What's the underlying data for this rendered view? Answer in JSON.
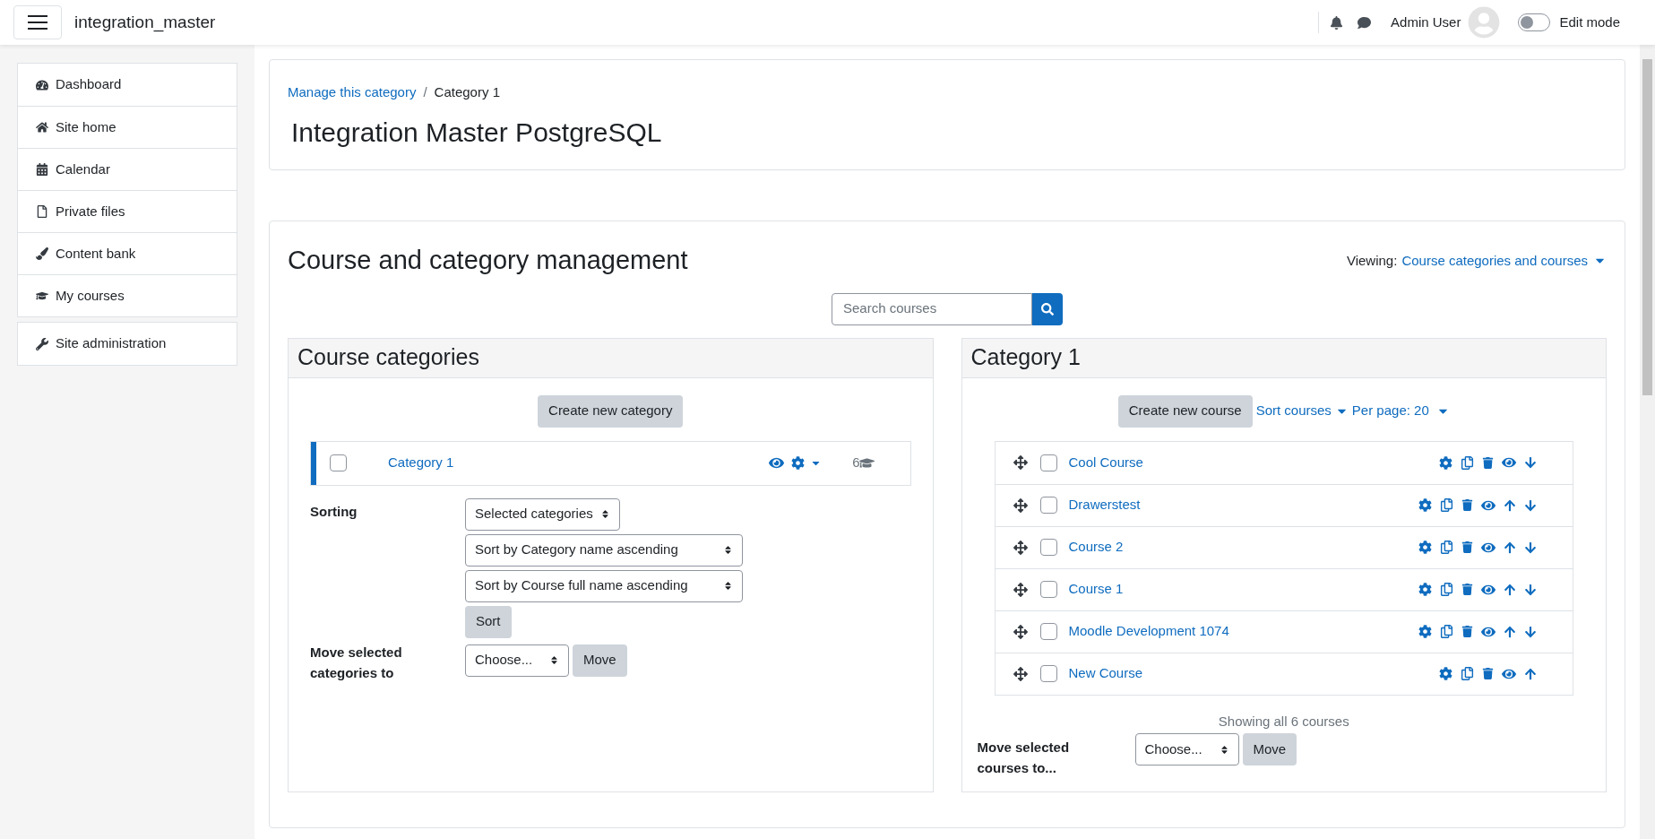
{
  "header": {
    "site_name": "integration_master",
    "user_name": "Admin User",
    "edit_mode": {
      "label": "Edit mode",
      "on": false
    }
  },
  "sidebar": {
    "groups": [
      [
        {
          "kind": "dashboard",
          "label": "Dashboard"
        },
        {
          "kind": "home",
          "label": "Site home"
        },
        {
          "kind": "calendar",
          "label": "Calendar"
        },
        {
          "kind": "file",
          "label": "Private files"
        },
        {
          "kind": "brush",
          "label": "Content bank"
        },
        {
          "kind": "courses",
          "label": "My courses"
        }
      ],
      [
        {
          "kind": "wrench",
          "label": "Site administration"
        }
      ]
    ]
  },
  "page_header": {
    "separator": "/",
    "breadcrumb": [
      {
        "label": "Manage this category",
        "link": true
      },
      {
        "label": "Category 1",
        "link": false
      }
    ],
    "title": "Integration Master PostgreSQL"
  },
  "management": {
    "title": "Course and category management",
    "viewing_label": "Viewing:",
    "viewing_value": "Course categories and courses",
    "search_placeholder": "Search courses",
    "categories_panel": {
      "title": "Course categories",
      "create_button": "Create new category",
      "categories": [
        {
          "name": "Category 1",
          "selected": true,
          "checked": false,
          "course_count": "6"
        }
      ],
      "sorting_label": "Sorting",
      "sort_selects": [
        "Selected categories",
        "Sort by Category name ascending",
        "Sort by Course full name ascending"
      ],
      "sort_button": "Sort",
      "move_label": "Move selected categories to",
      "move_select": "Choose...",
      "move_button": "Move"
    },
    "courses_panel": {
      "title": "Category 1",
      "create_button": "Create new course",
      "sort_link": "Sort courses",
      "per_page_link": "Per page: 20",
      "courses": [
        {
          "name": "Cool Course",
          "checked": false,
          "can_move_up": false,
          "can_move_down": true
        },
        {
          "name": "Drawerstest",
          "checked": false,
          "can_move_up": true,
          "can_move_down": true
        },
        {
          "name": "Course 2",
          "checked": false,
          "can_move_up": true,
          "can_move_down": true
        },
        {
          "name": "Course 1",
          "checked": false,
          "can_move_up": true,
          "can_move_down": true
        },
        {
          "name": "Moodle Development 1074",
          "checked": false,
          "can_move_up": true,
          "can_move_down": true
        },
        {
          "name": "New Course",
          "checked": false,
          "can_move_up": true,
          "can_move_down": false
        }
      ],
      "showing_text": "Showing all 6 courses",
      "move_label": "Move selected courses to...",
      "move_select": "Choose...",
      "move_button": "Move"
    }
  }
}
